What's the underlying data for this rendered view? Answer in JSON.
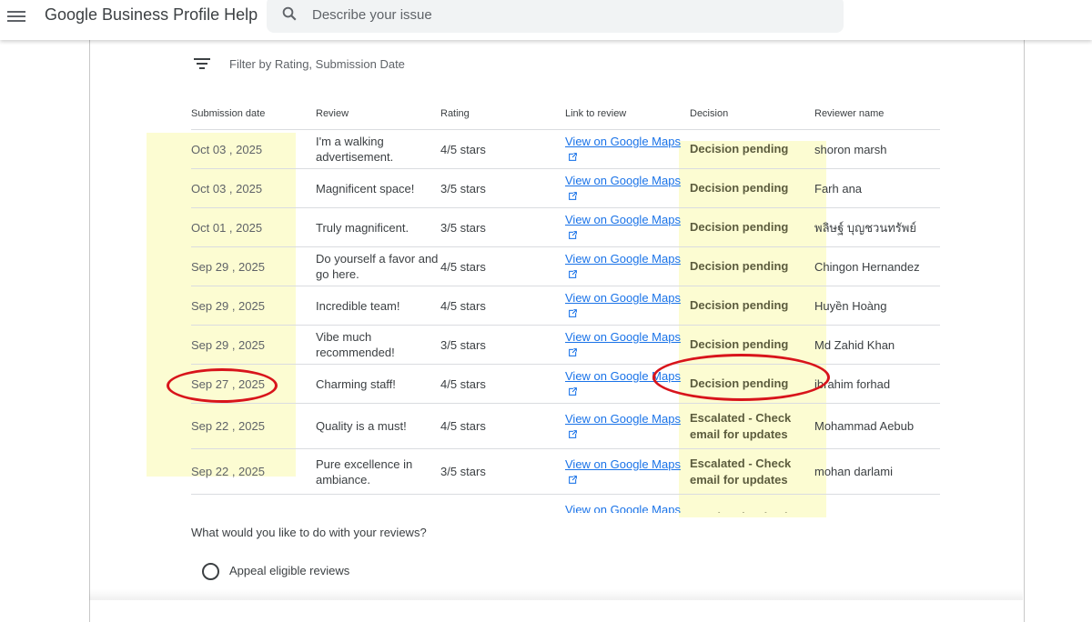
{
  "header": {
    "title": "Google Business Profile Help",
    "search_placeholder": "Describe your issue"
  },
  "filter": {
    "label": "Filter by Rating, Submission Date"
  },
  "table": {
    "columns": [
      "Submission date",
      "Review",
      "Rating",
      "Link to review",
      "Decision",
      "Reviewer name"
    ],
    "link_text": "View on Google Maps",
    "rows": [
      {
        "date": "Oct 03 , 2025",
        "review": "I'm a walking advertisement.",
        "rating": "4/5 stars",
        "decision": "Decision pending",
        "name": "shoron marsh"
      },
      {
        "date": "Oct 03 , 2025",
        "review": "Magnificent space!",
        "rating": "3/5 stars",
        "decision": "Decision pending",
        "name": "Farh ana"
      },
      {
        "date": "Oct 01 , 2025",
        "review": "Truly magnificent.",
        "rating": "3/5 stars",
        "decision": "Decision pending",
        "name": "พลิษฐ์ บุญชวนทรัพย์"
      },
      {
        "date": "Sep 29 , 2025",
        "review": "Do yourself a favor and go here.",
        "rating": "4/5 stars",
        "decision": "Decision pending",
        "name": "Chingon Hernandez"
      },
      {
        "date": "Sep 29 , 2025",
        "review": "Incredible team!",
        "rating": "4/5 stars",
        "decision": "Decision pending",
        "name": "Huyền Hoàng"
      },
      {
        "date": "Sep 29 , 2025",
        "review": "Vibe much recommended!",
        "rating": "3/5 stars",
        "decision": "Decision pending",
        "name": "Md Zahid Khan"
      },
      {
        "date": "Sep 27 , 2025",
        "review": "Charming staff!",
        "rating": "4/5 stars",
        "decision": "Decision pending",
        "name": "ibrahim forhad"
      },
      {
        "date": "Sep 22 , 2025",
        "review": "Quality is a must!",
        "rating": "4/5 stars",
        "decision": "Escalated - Check email for updates",
        "name": "Mohammad Aebub"
      },
      {
        "date": "Sep 22 , 2025",
        "review": "Pure excellence in ambiance.",
        "rating": "3/5 stars",
        "decision": "Escalated - Check email for updates",
        "name": "mohan darlami"
      },
      {
        "date": "",
        "review": "",
        "rating": "",
        "decision": "Escalated - Check",
        "name": ""
      }
    ]
  },
  "question": "What would you like to do with your reviews?",
  "options": [
    "Appeal eligible reviews"
  ]
}
